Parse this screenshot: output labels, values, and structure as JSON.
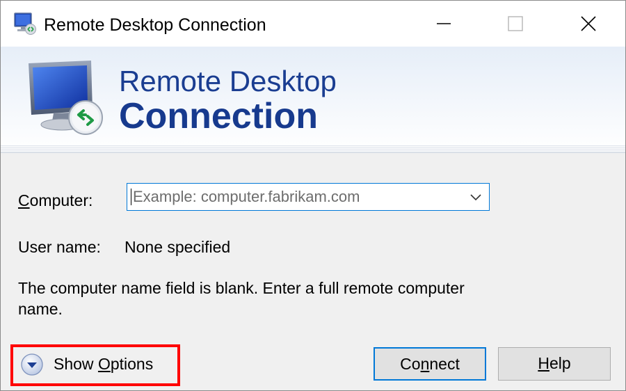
{
  "window": {
    "title": "Remote Desktop Connection"
  },
  "banner": {
    "line1": "Remote Desktop",
    "line2": "Connection"
  },
  "form": {
    "computer_label_access": "C",
    "computer_label_rest": "omputer:",
    "computer_value": "",
    "computer_placeholder": "Example: computer.fabrikam.com",
    "username_label": "User name:",
    "username_value": "None specified",
    "message": "The computer name field is blank. Enter a full remote computer name."
  },
  "actions": {
    "show_options_before": "Show ",
    "show_options_access": "O",
    "show_options_after": "ptions",
    "connect_before": "Co",
    "connect_access": "n",
    "connect_after": "nect",
    "help_access": "H",
    "help_after": "elp"
  },
  "colors": {
    "accent": "#0078d7",
    "banner_text": "#1a3d91",
    "highlight": "#ff0000"
  },
  "icons": {
    "app": "remote-desktop-icon",
    "minimize": "minimize-icon",
    "maximize": "maximize-icon",
    "close": "close-icon",
    "dropdown": "chevron-down-icon",
    "expand": "expand-circle-icon"
  }
}
